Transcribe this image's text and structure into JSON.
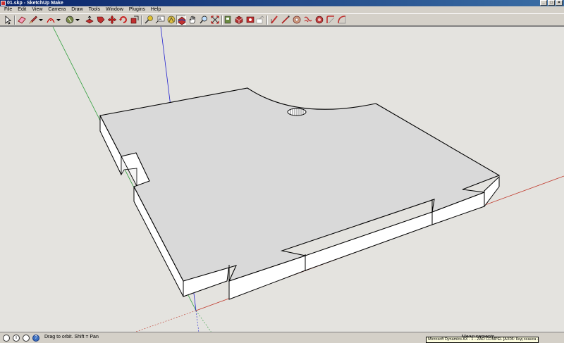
{
  "titlebar": {
    "title": "01.skp - SketchUp Make",
    "minimize": "_",
    "maximize": "□",
    "close": "×"
  },
  "menubar": {
    "items": [
      "File",
      "Edit",
      "View",
      "Camera",
      "Draw",
      "Tools",
      "Window",
      "Plugins",
      "Help"
    ]
  },
  "toolbar": {
    "tools": [
      {
        "name": "select-tool",
        "icon": "arrow-icon"
      },
      {
        "name": "eraser-tool",
        "icon": "eraser-icon"
      },
      {
        "name": "line-tool",
        "icon": "pencil-icon"
      },
      {
        "name": "arc-tool",
        "icon": "arc-icon"
      },
      {
        "name": "paint-bucket-tool",
        "icon": "paint-bucket-icon"
      },
      {
        "name": "push-pull-tool",
        "icon": "push-pull-icon"
      },
      {
        "name": "follow-me-tool",
        "icon": "follow-me-icon"
      },
      {
        "name": "move-tool",
        "icon": "move-icon"
      },
      {
        "name": "rotate-tool",
        "icon": "rotate-icon"
      },
      {
        "name": "scale-tool",
        "icon": "scale-icon"
      },
      {
        "name": "tape-measure-tool",
        "icon": "tape-measure-icon"
      },
      {
        "name": "text-tool",
        "icon": "text-icon"
      },
      {
        "name": "axes-tool",
        "icon": "axes-icon"
      },
      {
        "name": "orbit-tool",
        "icon": "orbit-icon"
      },
      {
        "name": "pan-tool",
        "icon": "hand-icon"
      },
      {
        "name": "zoom-tool",
        "icon": "magnifier-icon"
      },
      {
        "name": "zoom-extents-tool",
        "icon": "zoom-extents-icon"
      },
      {
        "name": "warehouse-tool",
        "icon": "warehouse-icon"
      },
      {
        "name": "components-tool",
        "icon": "components-icon"
      },
      {
        "name": "extension-warehouse-tool",
        "icon": "extension-icon"
      },
      {
        "name": "share-model-tool",
        "icon": "share-icon"
      },
      {
        "name": "sandbox-smoove-tool",
        "icon": "sandbox-icon"
      },
      {
        "name": "freehand-tool",
        "icon": "freehand-icon"
      },
      {
        "name": "bezier-tool",
        "icon": "bezier-icon"
      },
      {
        "name": "circle-plugin-tool",
        "icon": "circle-icon"
      },
      {
        "name": "round-corner-tool",
        "icon": "round-corner-icon"
      },
      {
        "name": "fillet-tool",
        "icon": "fillet-icon"
      },
      {
        "name": "curve-tool",
        "icon": "curve-icon"
      }
    ]
  },
  "statusbar": {
    "hint": "Drag to orbit.  Shift = Pan",
    "info_icon": "i",
    "help_icon": "?",
    "vcb_label": "Measurements"
  },
  "taskbar_tip": {
    "text": "Microsoft Dynamics AX - 1 - ZAO COMPEL [AX06: Код сеанса - 927]"
  },
  "colors": {
    "axis_red": "#c0392b",
    "axis_green": "#2e9e3a",
    "axis_blue": "#2020d0",
    "face": "#d9d9d9",
    "side": "#ffffff",
    "edge": "#000000"
  }
}
